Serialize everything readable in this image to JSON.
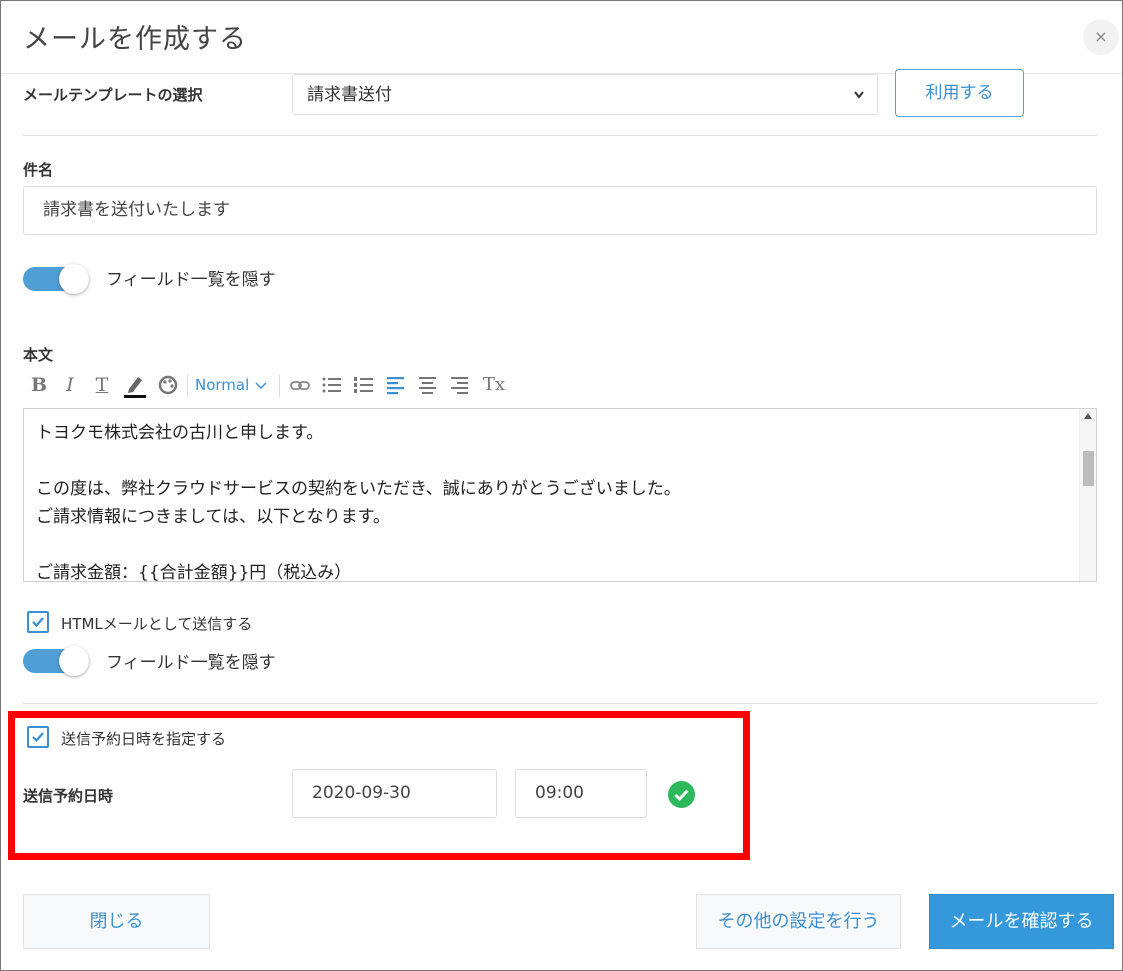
{
  "dialog": {
    "title": "メールを作成する",
    "close_glyph": "×"
  },
  "template": {
    "label": "メールテンプレートの選択",
    "selected": "請求書送付",
    "use_button": "利用する"
  },
  "subject": {
    "label": "件名",
    "value": "請求書を送付いたします"
  },
  "field_toggle_1": {
    "label": "フィールド一覧を隠す",
    "on": true
  },
  "body": {
    "label": "本文",
    "toolbar": {
      "bold": "B",
      "italic": "I",
      "underline": "T",
      "clear_format": "Tx",
      "size": "Normal"
    },
    "lines": [
      "トヨクモ株式会社の古川と申します。",
      "",
      "この度は、弊社クラウドサービスの契約をいただき、誠にありがとうございました。",
      "ご請求情報につきましては、以下となります。",
      "",
      "ご請求金額：{{合計金額}}円（税込み）"
    ]
  },
  "html_mail": {
    "label": "HTMLメールとして送信する",
    "checked": true
  },
  "field_toggle_2": {
    "label": "フィールド一覧を隠す",
    "on": true
  },
  "schedule": {
    "checkbox_label": "送信予約日時を指定する",
    "checked": true,
    "label": "送信予約日時",
    "date": "2020-09-30",
    "time": "09:00"
  },
  "footer": {
    "close": "閉じる",
    "other_settings": "その他の設定を行う",
    "confirm": "メールを確認する"
  },
  "colors": {
    "accent": "#3c8fd4",
    "toggle": "#4f9fd6",
    "primary_button": "#3498db",
    "highlight": "#ff0000",
    "ok": "#2eb85c"
  }
}
